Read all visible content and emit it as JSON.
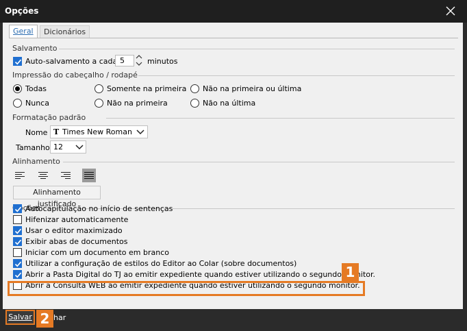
{
  "window": {
    "title": "Opções"
  },
  "tabs": {
    "active": "Geral",
    "inactive": "Dicionários"
  },
  "salvamento": {
    "section": "Salvamento",
    "autosave_label": "Auto-salvamento a cada",
    "autosave_checked": true,
    "interval_value": "5",
    "interval_unit": "minutos"
  },
  "impressao": {
    "section": "Impressão do cabeçalho / rodapé",
    "options": [
      "Todas",
      "Somente na primeira",
      "Não na primeira ou última",
      "Nunca",
      "Não na primeira",
      "Não na última"
    ],
    "selected": "Todas"
  },
  "formatacao": {
    "section": "Formatação padrão",
    "font_label": "Nome",
    "font_value": "Times New Roman",
    "size_label": "Tamanho",
    "size_value": "12"
  },
  "alinhamento": {
    "section": "Alinhamento",
    "selected": "justify",
    "selected_label": "Alinhamento justificado"
  },
  "opcoes": {
    "section": "Opções",
    "items": [
      {
        "label": "Autocapitulação no início de sentenças",
        "checked": true
      },
      {
        "label": "Hifenizar automaticamente",
        "checked": false
      },
      {
        "label": "Usar o editor maximizado",
        "checked": true
      },
      {
        "label": "Exibir abas de documentos",
        "checked": true
      },
      {
        "label": "Iniciar com um documento em branco",
        "checked": false
      },
      {
        "label": "Utilizar a configuração de estilos do Editor ao Colar (sobre documentos)",
        "checked": true
      },
      {
        "label": "Abrir a Pasta Digital do TJ ao emitir expediente quando estiver utilizando o segundo monitor.",
        "checked": true
      },
      {
        "label": "Abrir a Consulta WEB ao emitir expediente quando estiver utilizando o segundo monitor.",
        "checked": false
      }
    ]
  },
  "footer": {
    "save_label": "Salvar",
    "cancel_partial": "har"
  },
  "callouts": {
    "one": "1",
    "two": "2"
  },
  "colors": {
    "accent": "#1f6fd0",
    "callout": "#e57a24"
  }
}
